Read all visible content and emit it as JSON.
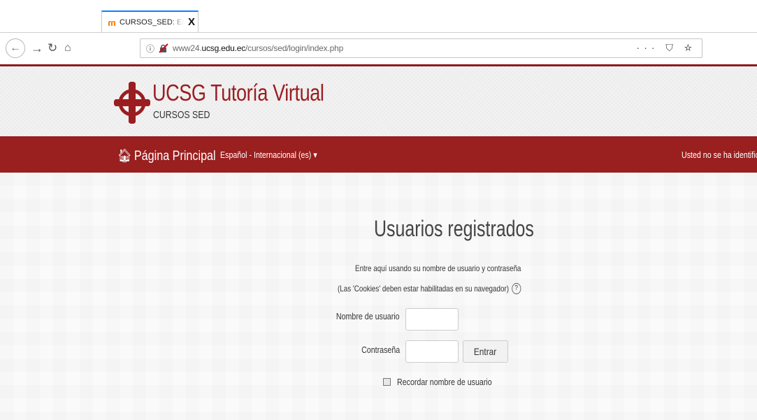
{
  "browser": {
    "tab_title": "CURSOS_SED: Entrar al sitio",
    "url_prefix": "www24.",
    "url_domain": "ucsg.edu.ec",
    "url_path": "/cursos/sed/login/index.php",
    "url_actions": "··· ⛉ ☆"
  },
  "header": {
    "title": "UCSG Tutoría Virtual",
    "subtitle": "CURSOS SED",
    "brand_color": "#9b1d20"
  },
  "nav": {
    "home": "Página Principal",
    "language": "Español - Internacional (es) ▾",
    "status": "Usted no se ha identificado."
  },
  "login": {
    "heading": "Usuarios registrados",
    "intro": "Entre aquí usando su nombre de usuario y contraseña",
    "cookies": "(Las 'Cookies' deben estar habilitadas en su navegador)",
    "username_label": "Nombre de usuario",
    "password_label": "Contraseña",
    "username_value": "",
    "password_value": "",
    "submit": "Entrar",
    "remember": "Recordar nombre de usuario"
  }
}
